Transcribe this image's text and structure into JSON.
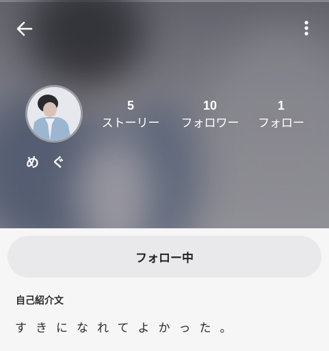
{
  "profile": {
    "username": "め ぐ",
    "stats": {
      "stories": {
        "value": "5",
        "label": "ストーリー"
      },
      "followers": {
        "value": "10",
        "label": "フォロワー"
      },
      "following": {
        "value": "1",
        "label": "フォロー"
      }
    }
  },
  "actions": {
    "follow_status_label": "フォロー中"
  },
  "bio": {
    "heading": "自己紹介文",
    "text": "すきになれてよかった。"
  },
  "icons": {
    "back": "arrow-left-icon",
    "menu": "more-vertical-icon"
  },
  "colors": {
    "header_text": "#ffffff",
    "button_background": "#e9e9eb",
    "page_background": "#f6f6f6"
  }
}
